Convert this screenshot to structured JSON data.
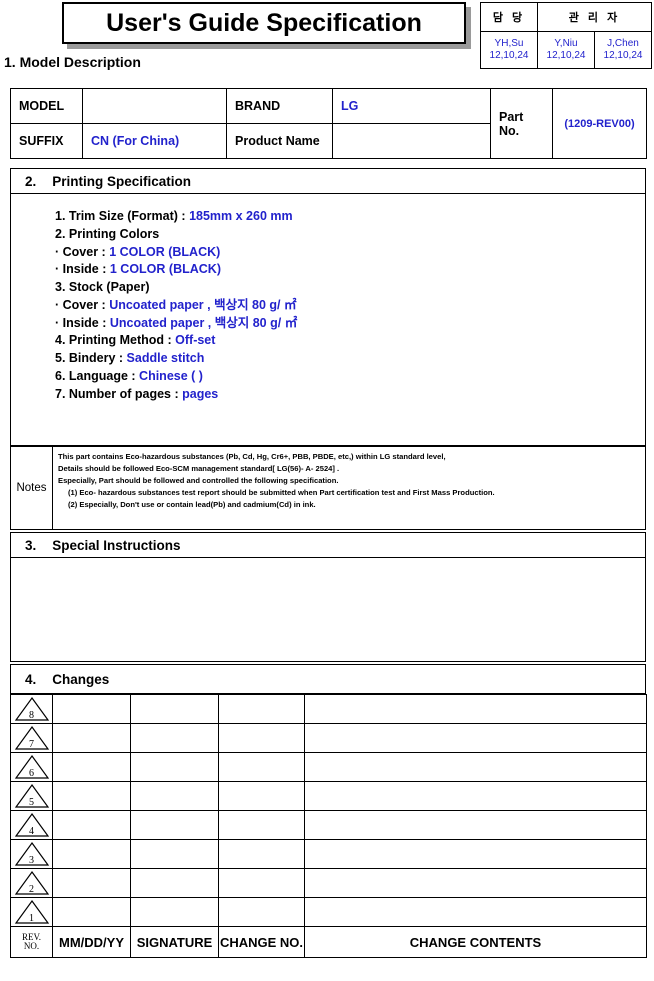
{
  "document": {
    "title": "User's Guide Specification"
  },
  "approval": {
    "headers": [
      "담  당",
      "관 리 자"
    ],
    "signers": [
      {
        "name": "YH,Su",
        "date": "12,10,24"
      },
      {
        "name": "Y,Niu",
        "date": "12,10,24"
      },
      {
        "name": "J,Chen",
        "date": "12,10,24"
      }
    ]
  },
  "section1": {
    "heading": "1. Model Description",
    "rows": [
      {
        "label": "MODEL",
        "value": "",
        "label2": "BRAND",
        "value2": "LG",
        "part_label": "Part No.",
        "part_value": "(1209-REV00)"
      },
      {
        "label": "SUFFIX",
        "value": "CN  (For China)",
        "label2": "Product Name",
        "value2": ""
      }
    ]
  },
  "section2": {
    "number": "2.",
    "heading": "Printing Specification",
    "items": [
      {
        "label": "1. Trim Size (Format) : ",
        "value": "185mm x 260 mm"
      },
      {
        "label": "2. Printing Colors",
        "value": ""
      },
      {
        "label": "· Cover : ",
        "value": "1 COLOR (BLACK)"
      },
      {
        "label": "· Inside : ",
        "value": "1 COLOR (BLACK)"
      },
      {
        "label": "3. Stock (Paper)",
        "value": ""
      },
      {
        "label": "· Cover : ",
        "value": "Uncoated paper , 백상지 80 g/ ㎡"
      },
      {
        "label": "· Inside : ",
        "value": "Uncoated paper , 백상지 80 g/ ㎡"
      },
      {
        "label": "4. Printing Method : ",
        "value": "Off-set"
      },
      {
        "label": "5. Bindery  : ",
        "value": "Saddle stitch"
      },
      {
        "label": "6. Language : ",
        "value": "Chinese (  )"
      },
      {
        "label": "7. Number of pages :     ",
        "value": "pages"
      }
    ]
  },
  "notes": {
    "label": "Notes",
    "lines": [
      "This part contains Eco-hazardous substances (Pb, Cd, Hg, Cr6+, PBB, PBDE, etc,) within LG standard level,",
      "Details should be followed Eco-SCM management standard[ LG(56)- A- 2524] .",
      "Especially, Part should be followed and controlled the following specification.",
      "(1) Eco- hazardous substances test report should be submitted when  Part certification test and First Mass Production.",
      "(2) Especially, Don't use or contain lead(Pb) and cadmium(Cd) in ink."
    ]
  },
  "section3": {
    "number": "3.",
    "heading": "Special Instructions",
    "content": ""
  },
  "section4": {
    "number": "4.",
    "heading": "Changes",
    "revisions": [
      {
        "rev": "8",
        "date": "",
        "signature": "",
        "change_no": "",
        "contents": ""
      },
      {
        "rev": "7",
        "date": "",
        "signature": "",
        "change_no": "",
        "contents": ""
      },
      {
        "rev": "6",
        "date": "",
        "signature": "",
        "change_no": "",
        "contents": ""
      },
      {
        "rev": "5",
        "date": "",
        "signature": "",
        "change_no": "",
        "contents": ""
      },
      {
        "rev": "4",
        "date": "",
        "signature": "",
        "change_no": "",
        "contents": ""
      },
      {
        "rev": "3",
        "date": "",
        "signature": "",
        "change_no": "",
        "contents": ""
      },
      {
        "rev": "2",
        "date": "",
        "signature": "",
        "change_no": "",
        "contents": ""
      },
      {
        "rev": "1",
        "date": "",
        "signature": "",
        "change_no": "",
        "contents": ""
      }
    ],
    "footer": {
      "rev_no_line1": "REV.",
      "rev_no_line2": "NO.",
      "date": "MM/DD/YY",
      "signature": "SIGNATURE",
      "change_no": "CHANGE NO.",
      "contents": "CHANGE   CONTENTS"
    }
  },
  "colors": {
    "value_blue": "#2222cc",
    "line_black": "#000000",
    "shadow_gray": "#9a9a9a"
  }
}
